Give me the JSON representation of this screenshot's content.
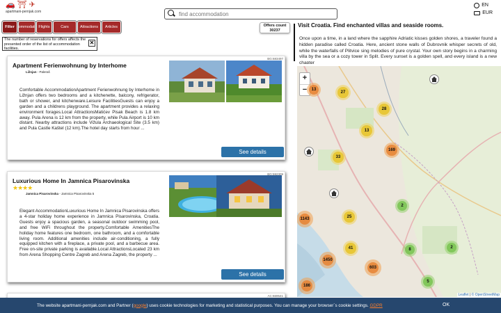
{
  "header": {
    "logo_text": "apartmani-pernjak.com",
    "search_placeholder": "find accommodation",
    "lang": "EN",
    "currency": "EUR"
  },
  "filters": [
    {
      "label": "Filter"
    },
    {
      "label": "Accommodations"
    },
    {
      "label": "Flights"
    },
    {
      "label": "Cars"
    },
    {
      "label": "Attractions"
    },
    {
      "label": "Articles"
    }
  ],
  "offers": {
    "label": "Offers count",
    "count": "30237"
  },
  "notice": {
    "text": "The number of reservations for offers affects the presented order of the list of accommodation facilities."
  },
  "listings": [
    {
      "id": "BG:683497",
      "title": "Apartment Ferienwohnung by Interhome",
      "location_bold": "Ližnjan",
      "location_rest": " - Paleraš",
      "description": "Comfortable AccommodationApartment Ferienwohnung by Interhome in Ližnjan offers two bedrooms and a kitchenette, balcony, refrigerator, bath or shower, and kitchenware.Leisure FacilitiesGuests can enjoy a garden and a childrens playground. The apartment provides a relaxing environment forages.Local AttractionsMatićev Pisak Beach is 1.8 km away. Pula Arena is 12 km from the property, while Pula Airport is 10 km distant. Nearby attractions include Vižula Archaeological Site (3.5 km) and Pula Castle Kaštel (12 km).The hotel day starts from hour ...",
      "button": "See details"
    },
    {
      "id": "BG:592309",
      "title": "Luxurious Home In Jamnica Pisarovinska",
      "stars": "★★★★",
      "location_bold": "Jamnica Pisarovinska",
      "location_rest": " - Jamnica Pisarovinska 5",
      "description": "Elegant AccommodationLuxurious Home In Jamnica Pisarovinska offers a 4-star holiday home experience in Jamnica Pisarovinska, Croatia. Guests enjoy a spacious garden, a seasonal outdoor swimming pool, and free WiFi throughout the property.Comfortable AmenitiesThe holiday home features one bedroom, one bathroom, and a comfortable living room. Additional amenities include air-conditioning, a fully equipped kitchen with a fireplace, a private pool, and a barbecue area. Free on-site private parking is available.Local AttractionsLocated 23 km from Arena Shopping Centre Zagreb and Arena Zagreb, the property ...",
      "button": "See details"
    },
    {
      "id": "AC:669541"
    }
  ],
  "right_panel": {
    "title": "Visit Croatia. Find enchanted villas and seaside rooms.",
    "text": "Once upon a time, in a land where the sapphire Adriatic kisses golden shores, a traveler found a hidden paradise called Croatia. Here, ancient stone walls of Dubrovnik whisper secrets of old, while the waterfalls of Plitvice sing melodies of pure crystal. Your own story begins in a charming villa by the sea or a cozy tower in Split. Every sunset is a golden spell, and every island is a new chapter"
  },
  "map": {
    "zoom_in": "+",
    "zoom_out": "−",
    "clusters": [
      {
        "count": "13",
        "color": "orange"
      },
      {
        "count": "27",
        "color": "yellow"
      },
      {
        "count": "28",
        "color": "yellow"
      },
      {
        "count": "13",
        "color": "yellow"
      },
      {
        "count": "169",
        "color": "orange"
      },
      {
        "count": "33",
        "color": "yellow"
      },
      {
        "count": "2",
        "color": "green"
      },
      {
        "count": "1143",
        "color": "orange"
      },
      {
        "count": "25",
        "color": "yellow"
      },
      {
        "count": "41",
        "color": "yellow"
      },
      {
        "count": "8",
        "color": "green"
      },
      {
        "count": "2",
        "color": "green"
      },
      {
        "count": "1450",
        "color": "orange"
      },
      {
        "count": "603",
        "color": "orange"
      },
      {
        "count": "186",
        "color": "orange"
      },
      {
        "count": "5",
        "color": "green"
      }
    ],
    "attribution_leaflet": "Leaflet",
    "attribution_osm": "© OpenStreetMap"
  },
  "cookie": {
    "text_before": "The website apartmani-pernjak.com and Partner (",
    "link_google": "google",
    "text_after": ") uses cookie technologies for marketing and statistical purposes. You can manage your browser´s cookie settings.",
    "link_gdpr": "GDPR",
    "ok": "OK"
  }
}
